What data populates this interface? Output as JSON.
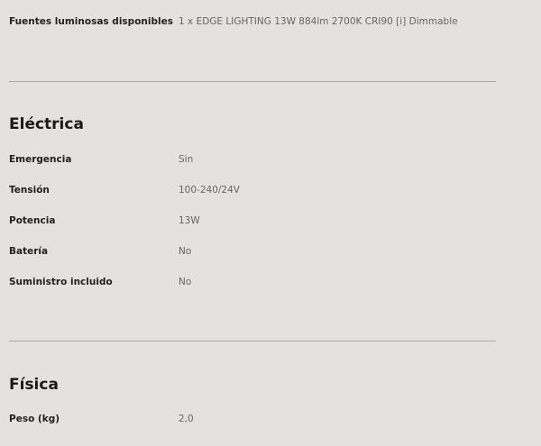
{
  "top_row": {
    "label": "Fuentes luminosas disponibles",
    "value": "1 x EDGE LIGHTING 13W 884lm 2700K CRI90 [i] Dimmable"
  },
  "electrica": {
    "title": "Eléctrica",
    "rows": [
      {
        "label": "Emergencia",
        "value": "Sin"
      },
      {
        "label": "Tensión",
        "value": "100-240/24V"
      },
      {
        "label": "Potencia",
        "value": "13W"
      },
      {
        "label": "Batería",
        "value": "No"
      },
      {
        "label": "Suministro incluido",
        "value": "No"
      }
    ]
  },
  "fisica": {
    "title": "Física",
    "rows": [
      {
        "label": "Peso (kg)",
        "value": "2,0"
      }
    ]
  }
}
